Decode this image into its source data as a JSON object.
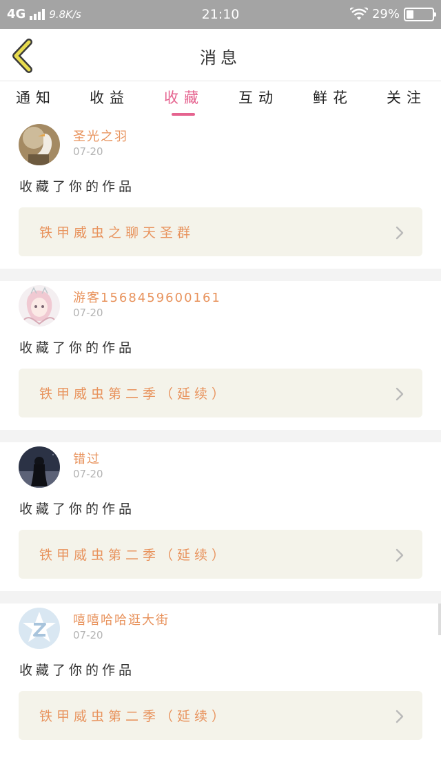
{
  "status_bar": {
    "network": "4G",
    "speed": "9.8K/s",
    "time": "21:10",
    "battery": "29%",
    "battery_level": 0.29
  },
  "header": {
    "title": "消息"
  },
  "tabs": [
    {
      "label": "通知",
      "active": false
    },
    {
      "label": "收益",
      "active": false
    },
    {
      "label": "收藏",
      "active": true
    },
    {
      "label": "互动",
      "active": false
    },
    {
      "label": "鲜花",
      "active": false
    },
    {
      "label": "关注",
      "active": false
    }
  ],
  "colors": {
    "accent": "#e5638f",
    "username": "#e8935d",
    "work_box": "#f4f3ea",
    "status_bar": "#a4a4a4",
    "back_arrow": "#e8dc4f"
  },
  "messages": [
    {
      "username": "圣光之羽",
      "date": "07-20",
      "action": "收藏了你的作品",
      "work_title": "铁甲威虫之聊天圣群",
      "avatar": "bird-avatar"
    },
    {
      "username": "游客1568459600161",
      "date": "07-20",
      "action": "收藏了你的作品",
      "work_title": "铁甲威虫第二季（延续）",
      "avatar": "anime-girl-avatar"
    },
    {
      "username": "错过",
      "date": "07-20",
      "action": "收藏了你的作品",
      "work_title": "铁甲威虫第二季（延续）",
      "avatar": "night-girl-avatar"
    },
    {
      "username": "嘻嘻哈哈逛大街",
      "date": "07-20",
      "action": "收藏了你的作品",
      "work_title": "铁甲威虫第二季（延续）",
      "avatar": "qq-default-avatar"
    }
  ]
}
